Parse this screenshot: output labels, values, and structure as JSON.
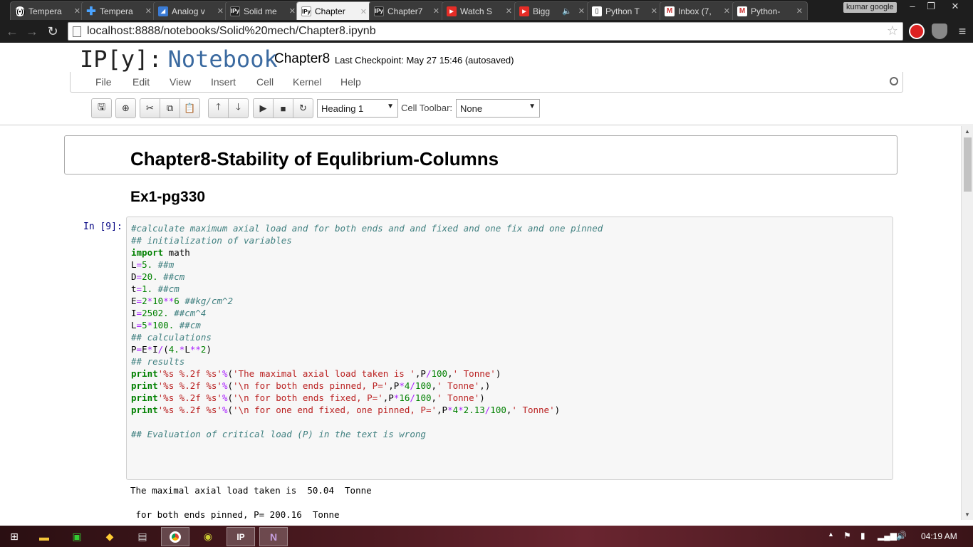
{
  "browser": {
    "tabs": [
      {
        "title": "Tempera",
        "icon": "wifi-icon"
      },
      {
        "title": "Tempera",
        "icon": "plus-icon"
      },
      {
        "title": "Analog v",
        "icon": "chart-icon"
      },
      {
        "title": "Solid me",
        "icon": "ipython-icon"
      },
      {
        "title": "Chapter",
        "icon": "ipython-icon"
      },
      {
        "title": "Chapter7",
        "icon": "ipython-icon"
      },
      {
        "title": "Watch S",
        "icon": "youtube-icon"
      },
      {
        "title": "Bigg",
        "icon": "youtube-icon"
      },
      {
        "title": "Python T",
        "icon": "document-icon"
      },
      {
        "title": "Inbox (7,",
        "icon": "gmail-icon"
      },
      {
        "title": "Python-",
        "icon": "gmail-icon"
      }
    ],
    "active_tab_index": 4,
    "profile": "kumar google",
    "url": "localhost:8888/notebooks/Solid%20mech/Chapter8.ipynb"
  },
  "notebook": {
    "logo_ip": "IP[y]:",
    "logo_nb": "Notebook",
    "name": "Chapter8",
    "checkpoint": "Last Checkpoint: May 27 15:46 (autosaved)",
    "menu": [
      "File",
      "Edit",
      "View",
      "Insert",
      "Cell",
      "Kernel",
      "Help"
    ],
    "cell_type": "Heading 1",
    "cell_toolbar_label": "Cell Toolbar:",
    "cell_toolbar_value": "None"
  },
  "content": {
    "heading1": "Chapter8-Stability of Equlibrium-Columns",
    "heading2": "Ex1-pg330",
    "prompt": "In [9]:",
    "output_lines": [
      "The maximal axial load taken is  50.04  Tonne",
      " for both ends pinned, P= 200.16  Tonne"
    ]
  },
  "taskbar": {
    "clock": "04:19 AM"
  }
}
